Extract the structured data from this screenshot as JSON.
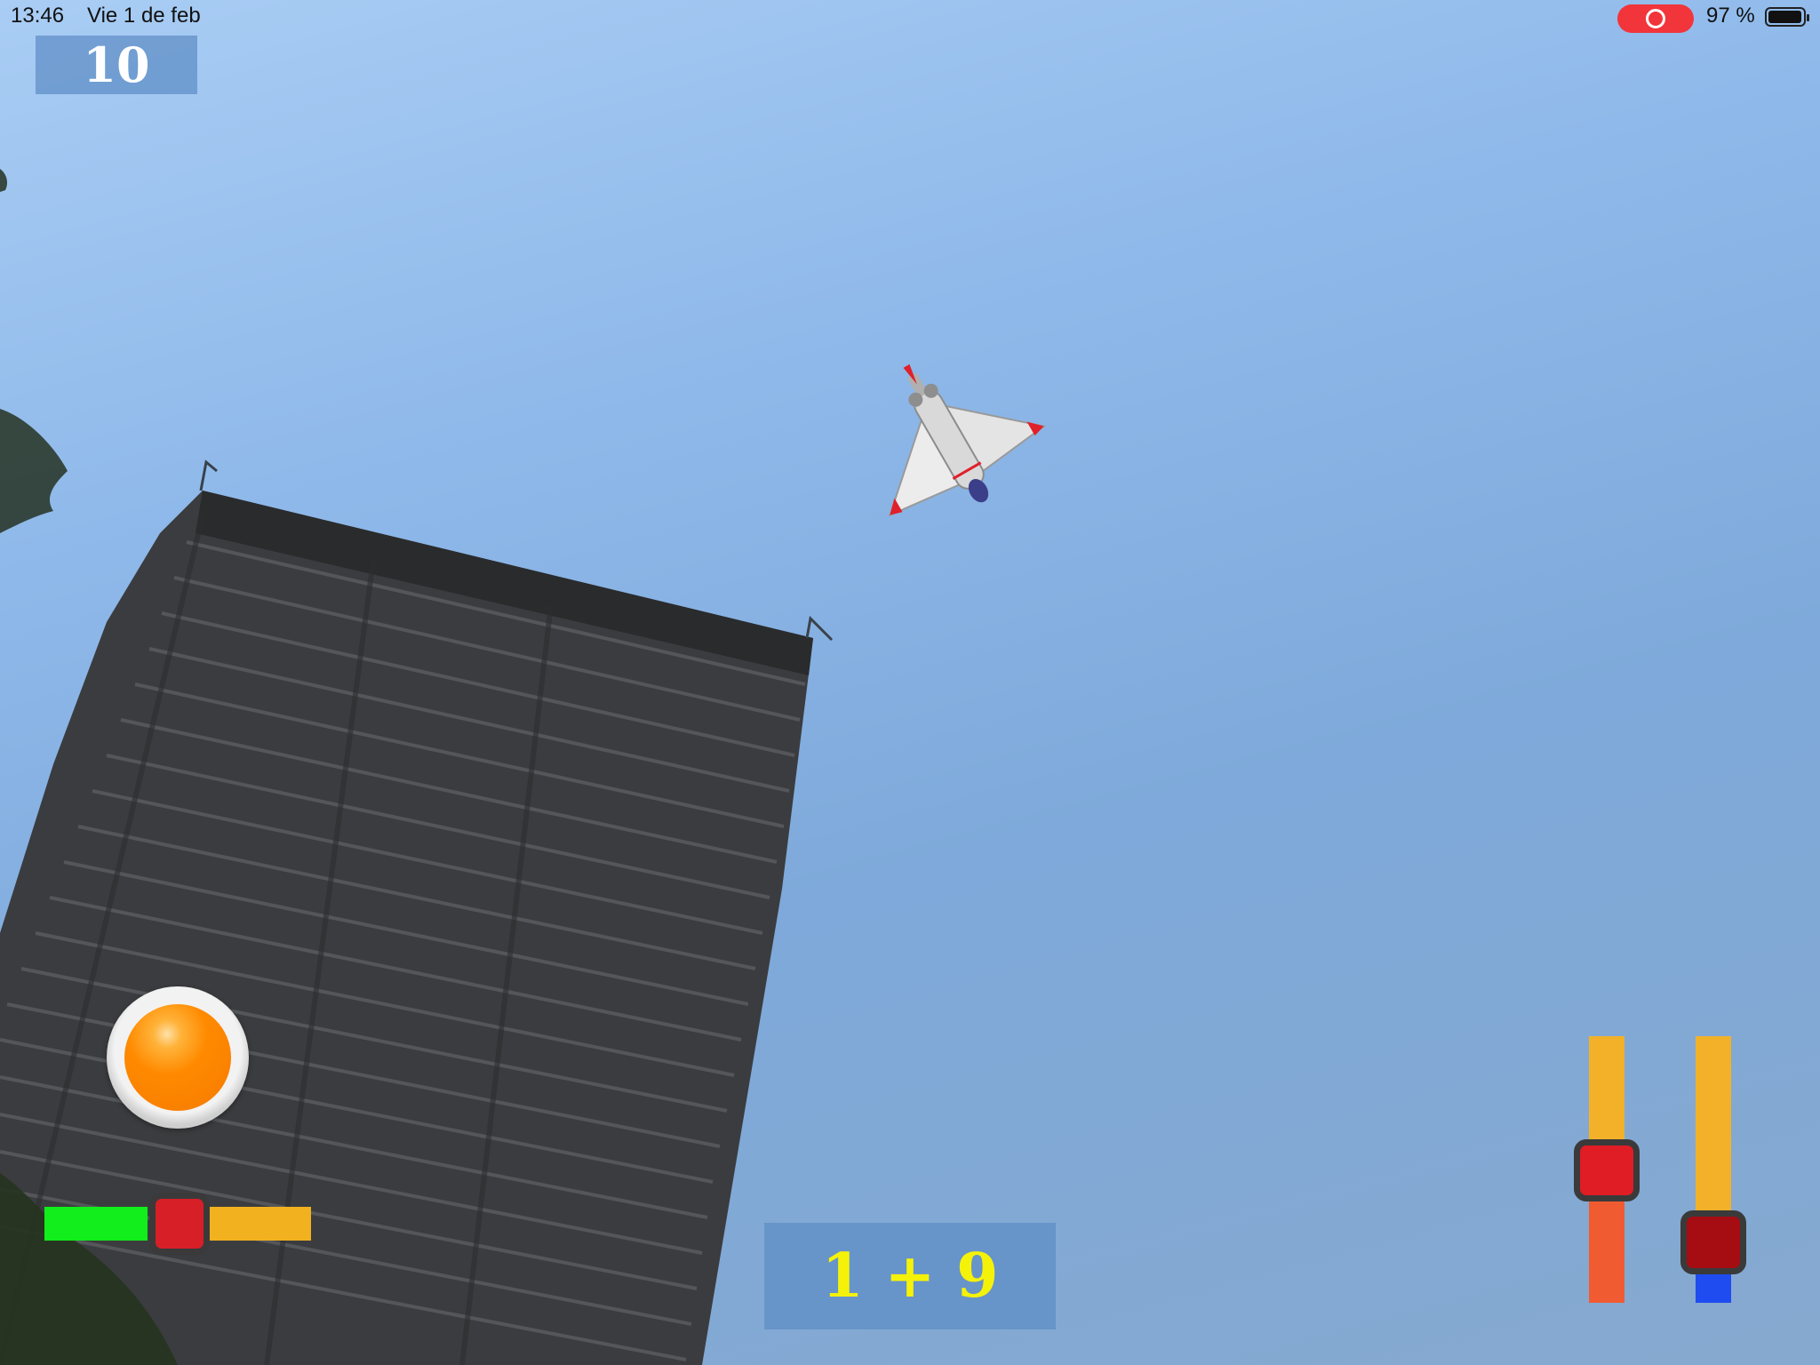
{
  "status_bar": {
    "time": "13:46",
    "date": "Vie 1 de feb",
    "battery_percent": "97 %",
    "recording": true,
    "battery_level": 0.97
  },
  "hud": {
    "score": "10",
    "math_question": "1 + 9"
  },
  "controls": {
    "fire_button_color": "#ff8a00",
    "roll_slider_value": 0.5,
    "left_vertical_slider_value": 0.62,
    "right_vertical_slider_value": 0.35
  },
  "scene": {
    "sky_color": "#8fb9ea",
    "building_color": "#3d3e40",
    "plane_wing_tip_color": "#e0202a"
  }
}
